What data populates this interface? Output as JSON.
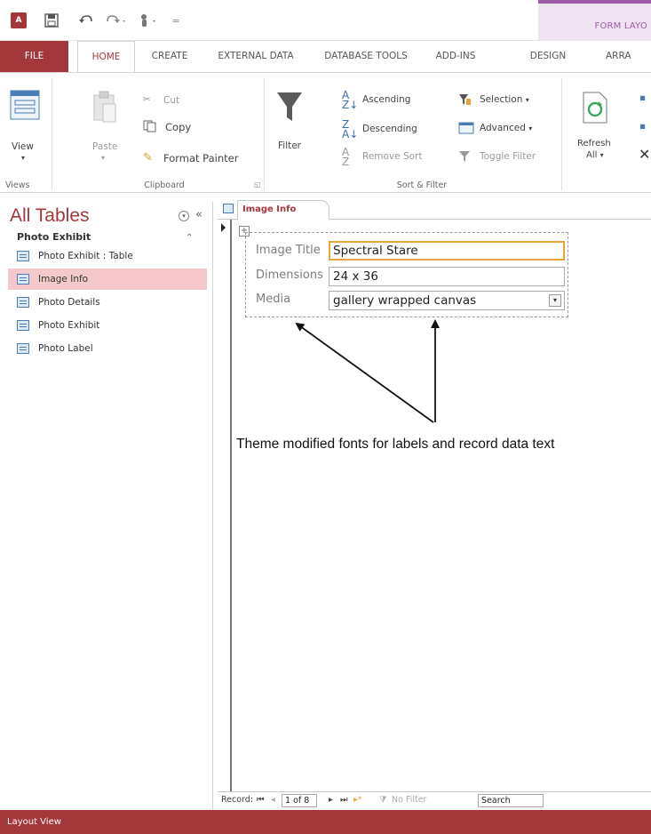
{
  "qat": {
    "icons": [
      "access-logo-icon",
      "save-icon",
      "undo-icon",
      "redo-icon",
      "touch-mode-icon",
      "customize-qat-icon"
    ],
    "context_tab": "FORM LAYO"
  },
  "tabs": [
    "FILE",
    "HOME",
    "CREATE",
    "EXTERNAL DATA",
    "DATABASE TOOLS",
    "ADD-INS",
    "DESIGN",
    "ARRA"
  ],
  "ribbon": {
    "views": {
      "view": "View",
      "label": "Views"
    },
    "clipboard": {
      "paste": "Paste",
      "cut": "Cut",
      "copy": "Copy",
      "format_painter": "Format Painter",
      "label": "Clipboard"
    },
    "sort_filter": {
      "filter": "Filter",
      "ascending": "Ascending",
      "descending": "Descending",
      "remove_sort": "Remove Sort",
      "selection": "Selection",
      "advanced": "Advanced",
      "toggle_filter": "Toggle Filter",
      "label": "Sort & Filter"
    },
    "records": {
      "refresh": "Refresh",
      "all": "All"
    }
  },
  "nav": {
    "title": "All Tables",
    "group": "Photo Exhibit",
    "items": [
      {
        "label": "Photo Exhibit : Table",
        "icon": "table-icon"
      },
      {
        "label": "Image Info",
        "icon": "form-icon",
        "selected": true
      },
      {
        "label": "Photo Details",
        "icon": "form-icon"
      },
      {
        "label": "Photo Exhibit",
        "icon": "form-icon"
      },
      {
        "label": "Photo Label",
        "icon": "form-icon"
      }
    ]
  },
  "document": {
    "tab": "Image Info",
    "fields": [
      {
        "label": "Image Title",
        "value": "Spectral Stare"
      },
      {
        "label": "Dimensions",
        "value": "24 x 36"
      },
      {
        "label": "Media",
        "value": "gallery wrapped canvas"
      }
    ],
    "callout": "Theme modified fonts for labels and record data text"
  },
  "record_nav": {
    "label": "Record:",
    "position": "1 of 8",
    "filter": "No Filter",
    "search": "Search"
  },
  "status": "Layout View",
  "colors": {
    "access_red": "#a4373a",
    "context_purple": "#9b5ba5",
    "focus_orange": "#e8a33d",
    "selected_nav": "#f5c9cb"
  }
}
